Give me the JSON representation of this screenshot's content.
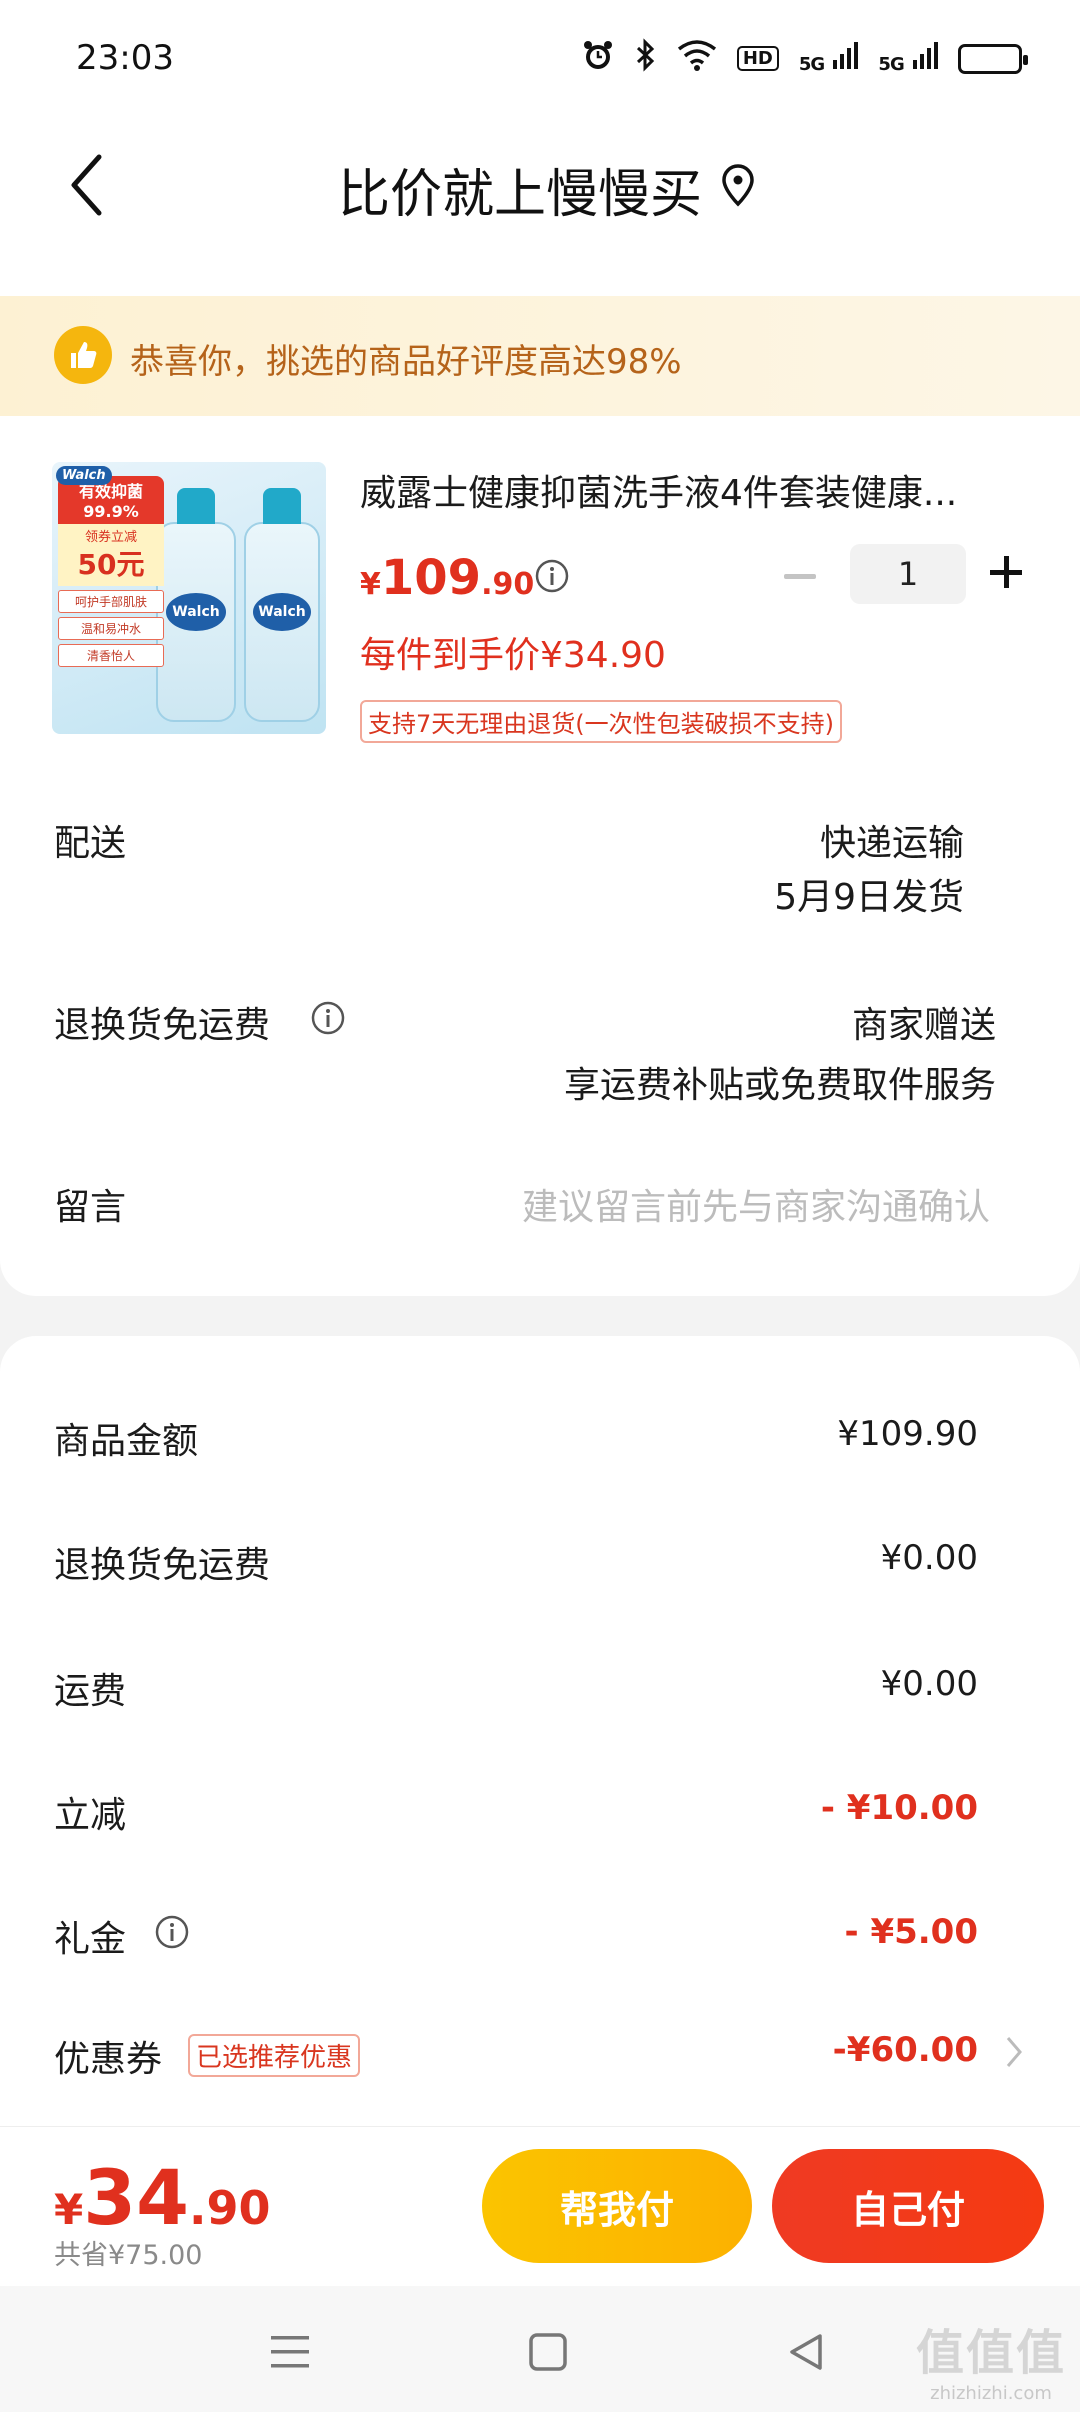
{
  "status_bar": {
    "time": "23:03",
    "icons": [
      "alarm-icon",
      "bluetooth-icon",
      "wifi-icon",
      "hd-icon",
      "signal-5g-icon",
      "signal-5g-icon",
      "battery-icon"
    ],
    "hd_label": "HD",
    "net1": "5G",
    "net2": "5G"
  },
  "header": {
    "title": "比价就上慢慢买",
    "back_icon": "chevron-left-icon",
    "location_icon": "location-pin-icon"
  },
  "banner": {
    "icon": "thumbs-up-icon",
    "text": "恭喜你，挑选的商品好评度高达98%"
  },
  "product": {
    "name": "威露士健康抑菌洗手液4件套装健康...",
    "image": {
      "brand": "Walch",
      "promo_top": "有效抑菌\n99.9%",
      "promo_small": "领券立减",
      "promo_amount": "50元",
      "tags": [
        "呵护手部肌肤",
        "温和易冲水",
        "清香怡人"
      ]
    },
    "price_currency": "¥",
    "price_int": "109",
    "price_dec": ".90",
    "quantity": "1",
    "unit_price": "每件到手价¥34.90",
    "return_policy": "支持7天无理由退货(一次性包装破损不支持)"
  },
  "delivery": {
    "label": "配送",
    "method": "快递运输",
    "ship_date": "5月9日发货"
  },
  "return_shipping": {
    "label": "退换货免运费",
    "value": "商家赠送",
    "detail": "享运费补贴或免费取件服务"
  },
  "message": {
    "label": "留言",
    "placeholder": "建议留言前先与商家沟通确认"
  },
  "costs": {
    "items": [
      {
        "label": "商品金额",
        "value": "¥109.90"
      },
      {
        "label": "退换货免运费",
        "value": "¥0.00"
      },
      {
        "label": "运费",
        "value": "¥0.00"
      },
      {
        "label": "立减",
        "value": "- ¥10.00"
      },
      {
        "label": "礼金",
        "value": "- ¥5.00"
      },
      {
        "label": "优惠券",
        "value": "-¥60.00"
      }
    ],
    "coupon_tag": "已选推荐优惠"
  },
  "bottom": {
    "total_currency": "¥",
    "total_int": "34",
    "total_dec": ".90",
    "saved": "共省¥75.00",
    "help_pay": "帮我付",
    "self_pay": "自己付"
  },
  "watermark": {
    "top": "值值值",
    "bottom": "zhizhizhi.com"
  },
  "colors": {
    "price_red": "#e0301e",
    "banner_text": "#b5631a",
    "help_button": "#fbc400",
    "self_button": "#f53a12"
  }
}
